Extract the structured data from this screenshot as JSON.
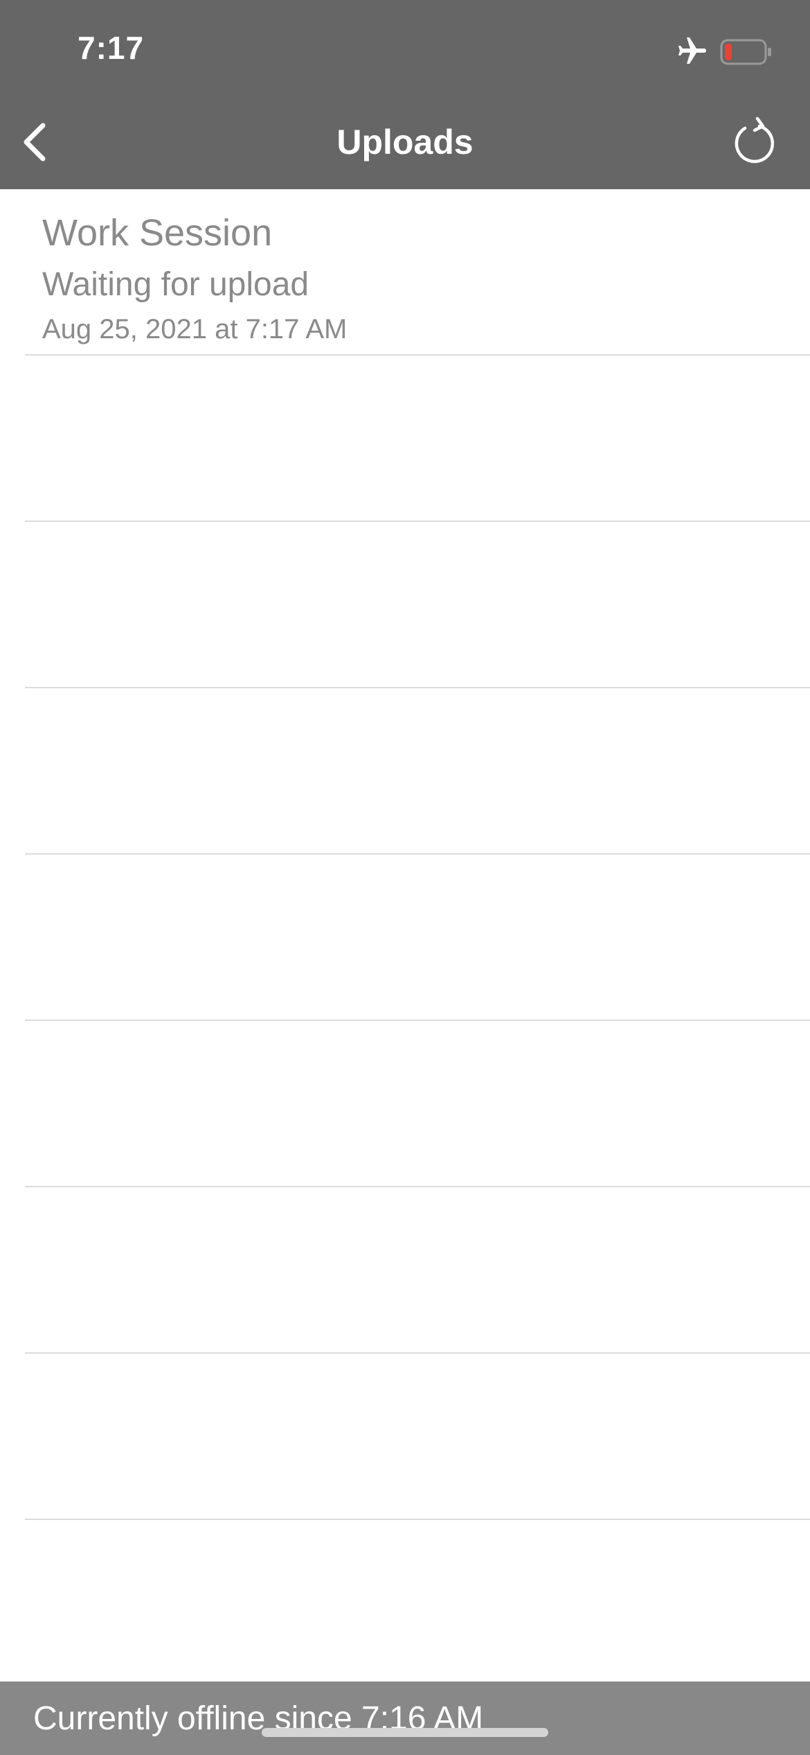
{
  "status_bar": {
    "time": "7:17",
    "airplane_icon": "airplane-icon",
    "battery_icon": "battery-low-icon",
    "battery_color": "#e5443a"
  },
  "nav": {
    "title": "Uploads",
    "back_icon": "chevron-left-icon",
    "refresh_icon": "refresh-icon"
  },
  "uploads": [
    {
      "title": "Work Session",
      "status": "Waiting for upload",
      "date": "Aug 25, 2021 at 7:17 AM"
    }
  ],
  "footer": {
    "offline_text": "Currently offline since 7:16 AM"
  },
  "colors": {
    "header_bg": "#666666",
    "footer_bg": "#888888",
    "text_gray": "#8a8a8a"
  }
}
